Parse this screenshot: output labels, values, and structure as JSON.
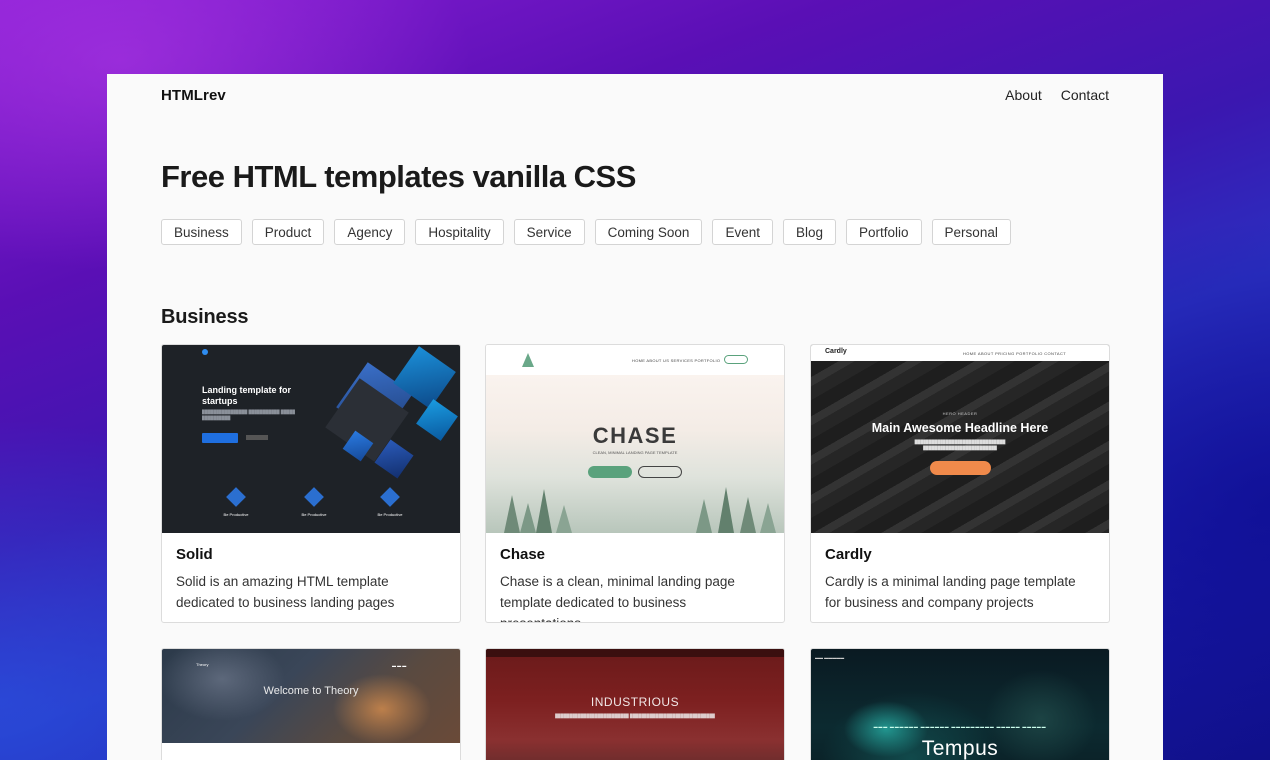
{
  "nav": {
    "brand": "HTMLrev",
    "links": [
      "About",
      "Contact"
    ]
  },
  "hero": {
    "title": "Free HTML templates vanilla CSS"
  },
  "tags": [
    "Business",
    "Product",
    "Agency",
    "Hospitality",
    "Service",
    "Coming Soon",
    "Event",
    "Blog",
    "Portfolio",
    "Personal"
  ],
  "section": {
    "title": "Business"
  },
  "cards": [
    {
      "name": "Solid",
      "desc": "Solid is an amazing HTML template dedicated to business landing pages",
      "thumb": {
        "headline": "Landing template for startups",
        "primary_button": "",
        "features": [
          "Be Productive",
          "Be Productive",
          "Be Productive"
        ]
      }
    },
    {
      "name": "Chase",
      "desc": "Chase is a clean, minimal landing page template dedicated to business presentations",
      "thumb": {
        "menu": "HOME   ABOUT US   SERVICES   PORTFOLIO",
        "title": "CHASE",
        "subtitle": "CLEAN, MINIMAL LANDING PAGE TEMPLATE"
      }
    },
    {
      "name": "Cardly",
      "desc": "Cardly is a minimal landing page template for business and company projects",
      "thumb": {
        "logo": "Cardly",
        "menu": "HOME   ABOUT   PRICING   PORTFOLIO   CONTACT",
        "eyebrow": "HERO HEADER",
        "headline": "Main Awesome Headline Here"
      }
    },
    {
      "name": "",
      "desc": "",
      "thumb": {
        "logo": "Theory",
        "title": "Welcome to Theory"
      }
    },
    {
      "name": "",
      "desc": "",
      "thumb": {
        "title": "INDUSTRIOUS"
      }
    },
    {
      "name": "",
      "desc": "",
      "thumb": {
        "title": "Tempus"
      }
    }
  ],
  "colors": {
    "page_bg": "#fafafa",
    "accent_blue": "#1f6fe0",
    "chase_green": "#5aa27c",
    "cardly_orange": "#f08a4b"
  }
}
